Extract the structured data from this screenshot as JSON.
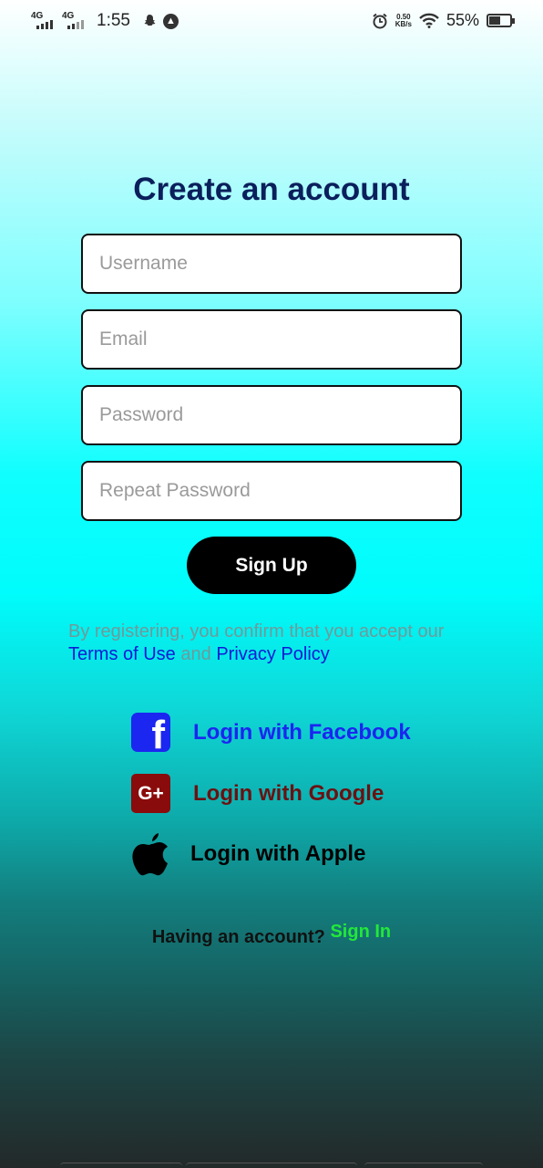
{
  "status_bar": {
    "net1": "4G",
    "net2": "4G",
    "time": "1:55",
    "speed_value": "0.50",
    "speed_unit": "KB/s",
    "battery": "55%",
    "battery_level": 0.55,
    "icons": [
      "signal-icon",
      "signal-icon",
      "snapchat-icon",
      "notification-icon",
      "alarm-icon",
      "wifi-icon",
      "battery-icon"
    ]
  },
  "form": {
    "title": "Create an account",
    "username_placeholder": "Username",
    "email_placeholder": "Email",
    "password_placeholder": "Password",
    "repeat_password_placeholder": "Repeat Password",
    "submit_label": "Sign Up"
  },
  "terms": {
    "prefix": "By registering, you confirm that you accept our",
    "terms_link": "Terms of Use",
    "conjunction": "and",
    "privacy_link": "Privacy Policy"
  },
  "social": {
    "facebook": {
      "label": "Login with Facebook",
      "icon_letter": "f",
      "color": "#1b26f0"
    },
    "google": {
      "label": "Login with Google",
      "icon_letter": "G+",
      "color": "#6b1111"
    },
    "apple": {
      "label": "Login with Apple",
      "color": "#000000"
    }
  },
  "footer": {
    "prompt": "Having an account?",
    "signin_label": "Sign In",
    "signin_color": "#22e83a"
  }
}
